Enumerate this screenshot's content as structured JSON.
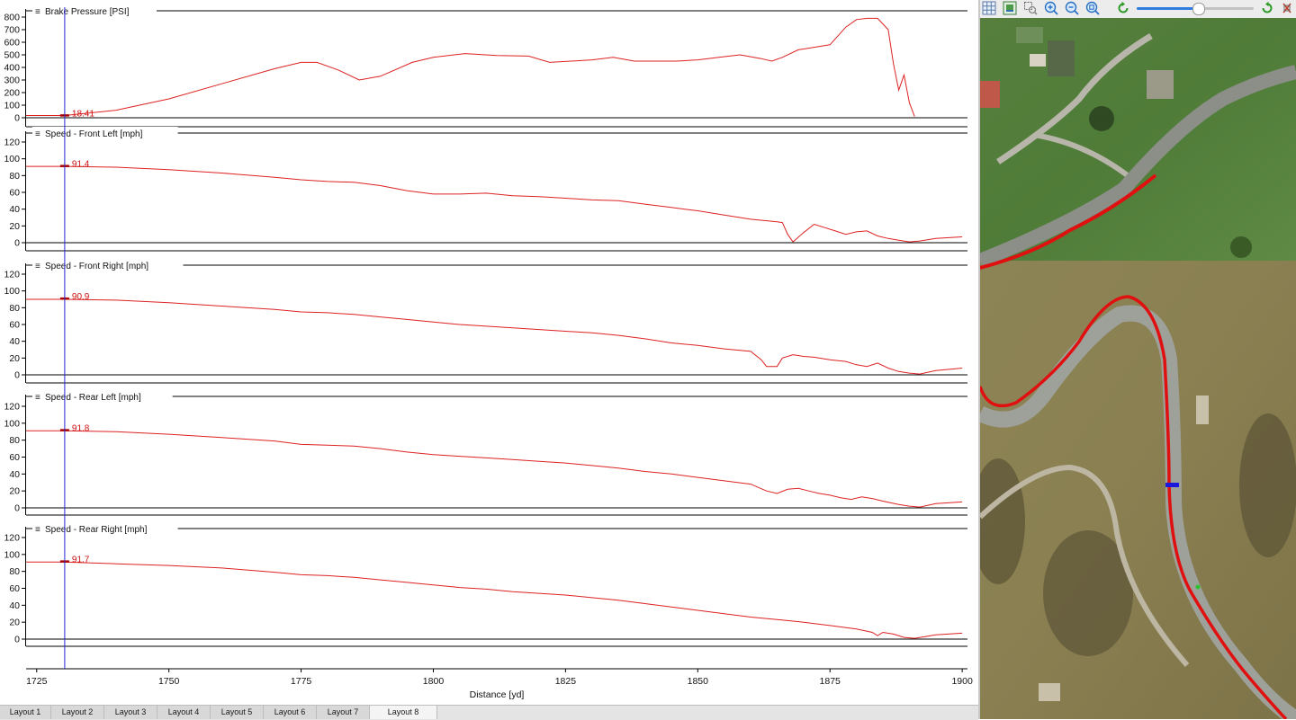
{
  "x_axis": {
    "label": "Distance [yd]",
    "ticks": [
      1725,
      1750,
      1775,
      1800,
      1825,
      1850,
      1875,
      1900
    ],
    "range": [
      1723,
      1901
    ]
  },
  "cursor": {
    "x": 1730.3
  },
  "charts": [
    {
      "title": "Brake Pressure [PSI]",
      "yticks": [
        0,
        100,
        200,
        300,
        400,
        500,
        600,
        700,
        800
      ],
      "ylim": [
        0,
        800
      ],
      "cursor_value": "18.41",
      "color": "#dd2222"
    },
    {
      "title": "Speed - Front Left [mph]",
      "yticks": [
        0,
        20,
        40,
        60,
        80,
        100,
        120
      ],
      "ylim": [
        0,
        120
      ],
      "cursor_value": "91.4",
      "color": "#dd2222"
    },
    {
      "title": "Speed - Front Right [mph]",
      "yticks": [
        0,
        20,
        40,
        60,
        80,
        100,
        120
      ],
      "ylim": [
        0,
        120
      ],
      "cursor_value": "90.9",
      "color": "#dd2222"
    },
    {
      "title": "Speed - Rear Left [mph]",
      "yticks": [
        0,
        20,
        40,
        60,
        80,
        100,
        120
      ],
      "ylim": [
        0,
        120
      ],
      "cursor_value": "91.8",
      "color": "#dd2222"
    },
    {
      "title": "Speed - Rear Right [mph]",
      "yticks": [
        0,
        20,
        40,
        60,
        80,
        100,
        120
      ],
      "ylim": [
        0,
        120
      ],
      "cursor_value": "91.7",
      "color": "#dd2222"
    }
  ],
  "chart_data": [
    {
      "type": "line",
      "title": "Brake Pressure [PSI]",
      "xlabel": "Distance [yd]",
      "ylabel": "",
      "ylim": [
        0,
        800
      ],
      "xlim": [
        1723,
        1901
      ],
      "series": [
        {
          "x": [
            1723,
            1730.3,
            1740,
            1750,
            1760,
            1770,
            1775,
            1778,
            1782,
            1786,
            1790,
            1796,
            1800,
            1806,
            1812,
            1818,
            1822,
            1826,
            1830,
            1834,
            1838,
            1842,
            1846,
            1850,
            1854,
            1858,
            1862,
            1864,
            1866,
            1869,
            1872,
            1875,
            1878,
            1880,
            1882,
            1884,
            1886,
            1887,
            1888,
            1889,
            1890,
            1891
          ],
          "y": [
            18,
            18,
            60,
            150,
            270,
            390,
            440,
            440,
            380,
            300,
            330,
            440,
            480,
            510,
            495,
            490,
            440,
            450,
            460,
            480,
            450,
            450,
            450,
            460,
            480,
            500,
            470,
            450,
            480,
            540,
            560,
            580,
            720,
            780,
            790,
            790,
            700,
            430,
            220,
            340,
            120,
            10
          ]
        }
      ]
    },
    {
      "type": "line",
      "title": "Speed - Front Left [mph]",
      "xlabel": "Distance [yd]",
      "ylim": [
        0,
        120
      ],
      "xlim": [
        1723,
        1901
      ],
      "series": [
        {
          "x": [
            1723,
            1730.3,
            1740,
            1750,
            1760,
            1770,
            1775,
            1780,
            1785,
            1790,
            1795,
            1800,
            1805,
            1810,
            1815,
            1820,
            1825,
            1830,
            1835,
            1840,
            1845,
            1850,
            1855,
            1860,
            1865,
            1866,
            1867,
            1868,
            1870,
            1872,
            1874,
            1876,
            1878,
            1880,
            1882,
            1884,
            1886,
            1888,
            1890,
            1892,
            1895,
            1900
          ],
          "y": [
            91,
            91,
            90,
            87,
            83,
            78,
            75,
            73,
            72,
            68,
            62,
            58,
            58,
            59,
            56,
            55,
            53,
            51,
            50,
            46,
            42,
            38,
            33,
            28,
            25,
            24,
            10,
            1,
            12,
            22,
            18,
            14,
            10,
            13,
            14,
            8,
            5,
            3,
            1,
            2,
            5,
            7
          ]
        }
      ]
    },
    {
      "type": "line",
      "title": "Speed - Front Right [mph]",
      "xlabel": "Distance [yd]",
      "ylim": [
        0,
        120
      ],
      "xlim": [
        1723,
        1901
      ],
      "series": [
        {
          "x": [
            1723,
            1730.3,
            1740,
            1750,
            1760,
            1770,
            1775,
            1780,
            1785,
            1790,
            1795,
            1800,
            1805,
            1810,
            1815,
            1820,
            1825,
            1830,
            1835,
            1840,
            1845,
            1850,
            1855,
            1860,
            1862,
            1863,
            1865,
            1866,
            1868,
            1870,
            1872,
            1875,
            1878,
            1880,
            1882,
            1884,
            1886,
            1888,
            1890,
            1892,
            1895,
            1900
          ],
          "y": [
            90,
            90,
            89,
            86,
            82,
            78,
            75,
            74,
            72,
            69,
            66,
            63,
            60,
            58,
            56,
            54,
            52,
            50,
            47,
            43,
            38,
            35,
            31,
            28,
            18,
            10,
            10,
            20,
            24,
            22,
            21,
            18,
            16,
            12,
            10,
            14,
            8,
            4,
            2,
            1,
            5,
            8
          ]
        }
      ]
    },
    {
      "type": "line",
      "title": "Speed - Rear Left [mph]",
      "xlabel": "Distance [yd]",
      "ylim": [
        0,
        120
      ],
      "xlim": [
        1723,
        1901
      ],
      "series": [
        {
          "x": [
            1723,
            1730.3,
            1740,
            1750,
            1760,
            1770,
            1775,
            1780,
            1785,
            1790,
            1795,
            1800,
            1805,
            1810,
            1815,
            1820,
            1825,
            1830,
            1835,
            1840,
            1845,
            1850,
            1855,
            1860,
            1863,
            1865,
            1867,
            1869,
            1871,
            1873,
            1875,
            1877,
            1879,
            1881,
            1883,
            1885,
            1888,
            1890,
            1892,
            1895,
            1900
          ],
          "y": [
            91,
            91,
            90,
            87,
            83,
            79,
            75,
            74,
            73,
            70,
            66,
            63,
            61,
            59,
            57,
            55,
            53,
            50,
            47,
            43,
            40,
            36,
            32,
            28,
            20,
            17,
            22,
            23,
            20,
            17,
            15,
            12,
            10,
            13,
            11,
            8,
            4,
            2,
            1,
            5,
            7
          ]
        }
      ]
    },
    {
      "type": "line",
      "title": "Speed - Rear Right [mph]",
      "xlabel": "Distance [yd]",
      "ylim": [
        0,
        120
      ],
      "xlim": [
        1723,
        1901
      ],
      "series": [
        {
          "x": [
            1723,
            1730.3,
            1740,
            1750,
            1760,
            1770,
            1775,
            1780,
            1785,
            1790,
            1795,
            1800,
            1805,
            1810,
            1815,
            1820,
            1825,
            1830,
            1835,
            1840,
            1845,
            1850,
            1855,
            1860,
            1865,
            1870,
            1875,
            1880,
            1883,
            1884,
            1885,
            1887,
            1889,
            1891,
            1893,
            1895,
            1900
          ],
          "y": [
            91,
            91,
            89,
            87,
            84,
            79,
            76,
            75,
            73,
            70,
            67,
            64,
            61,
            59,
            56,
            54,
            52,
            49,
            46,
            42,
            38,
            34,
            30,
            26,
            23,
            20,
            16,
            12,
            8,
            4,
            8,
            6,
            2,
            1,
            3,
            5,
            7
          ]
        }
      ]
    }
  ],
  "layout_tabs": [
    {
      "label": "Layout 1",
      "active": false
    },
    {
      "label": "Layout 2",
      "active": false
    },
    {
      "label": "Layout 3",
      "active": false
    },
    {
      "label": "Layout 4",
      "active": false
    },
    {
      "label": "Layout 5",
      "active": false
    },
    {
      "label": "Layout 6",
      "active": false
    },
    {
      "label": "Layout 7",
      "active": false
    },
    {
      "label": "Layout 8",
      "active": true
    }
  ],
  "map_toolbar": {
    "buttons": [
      "grid-icon",
      "image-icon",
      "zoom-select-icon",
      "zoom-in-icon",
      "zoom-out-icon",
      "zoom-fit-icon",
      "rotate-left-icon",
      "rotate-right-icon",
      "clear-icon"
    ],
    "zoom_level": 0.52
  },
  "colors": {
    "trace": "#dd2222",
    "cursor": "#2a2acc",
    "axis": "#000000",
    "racing_line": "#e01010",
    "car_marker": "#1a1add"
  }
}
